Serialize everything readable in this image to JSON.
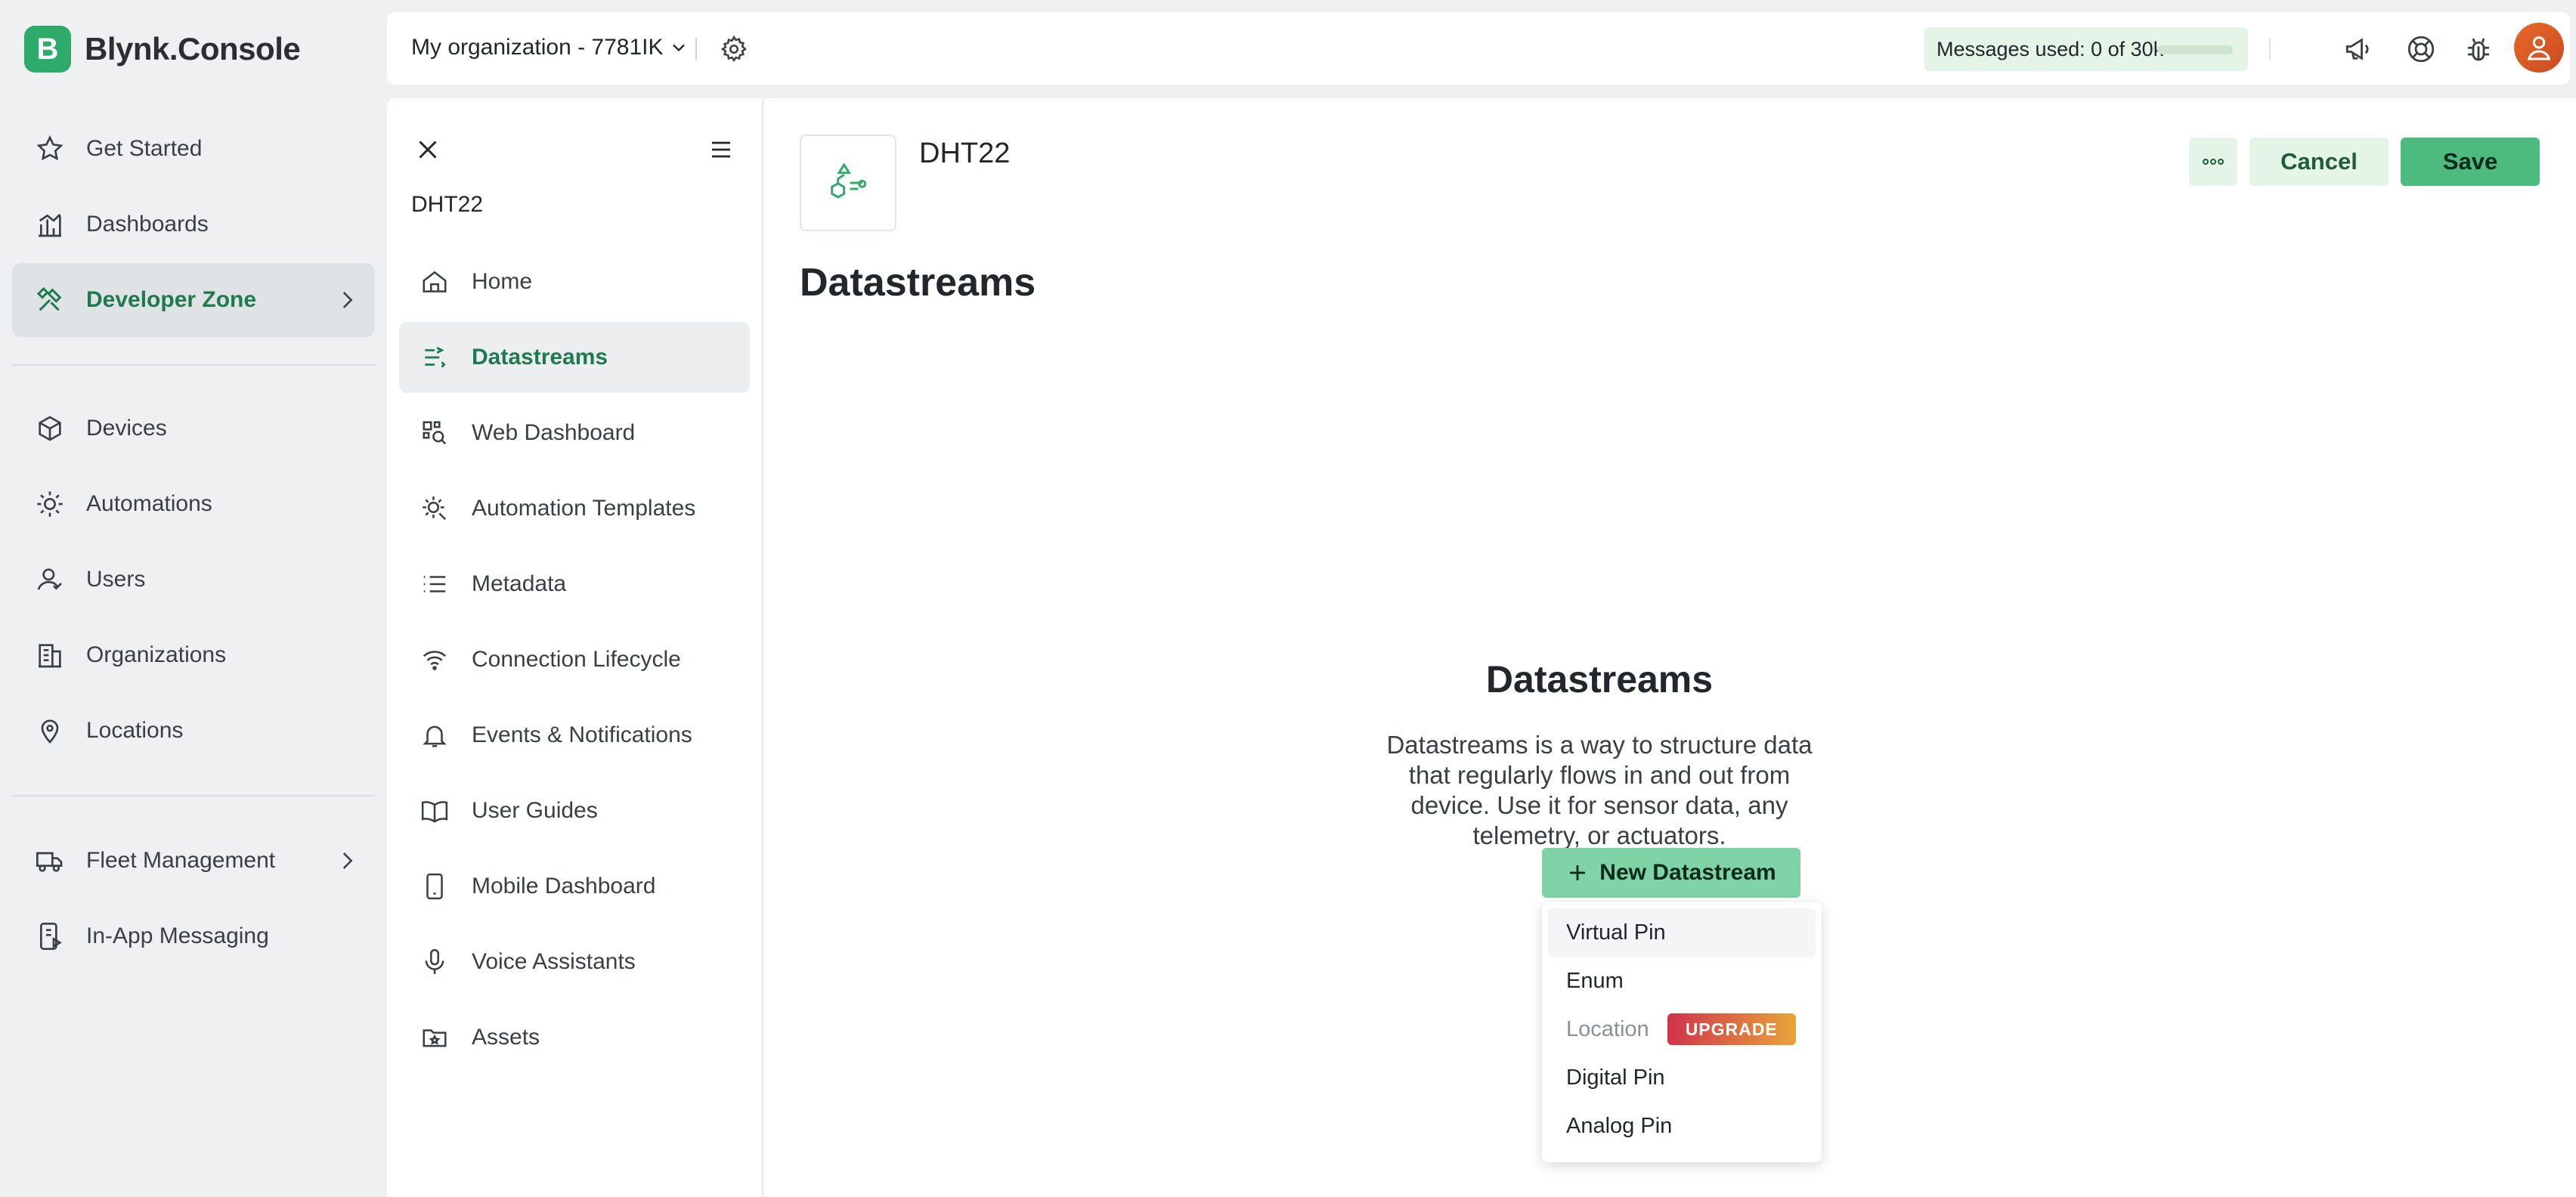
{
  "brand": {
    "letter": "B",
    "name": "Blynk.Console"
  },
  "nav": {
    "items": [
      {
        "label": "Get Started"
      },
      {
        "label": "Dashboards"
      },
      {
        "label": "Developer Zone"
      },
      {
        "label": "Devices"
      },
      {
        "label": "Automations"
      },
      {
        "label": "Users"
      },
      {
        "label": "Organizations"
      },
      {
        "label": "Locations"
      },
      {
        "label": "Fleet Management"
      },
      {
        "label": "In-App Messaging"
      }
    ]
  },
  "topbar": {
    "org_name": "My organization - 7781IK",
    "messages_label": "Messages used:",
    "messages_value": "0 of 30k",
    "messages_fraction": 0.0
  },
  "subnav": {
    "title": "DHT22",
    "items": [
      {
        "label": "Home"
      },
      {
        "label": "Datastreams"
      },
      {
        "label": "Web Dashboard"
      },
      {
        "label": "Automation Templates"
      },
      {
        "label": "Metadata"
      },
      {
        "label": "Connection Lifecycle"
      },
      {
        "label": "Events & Notifications"
      },
      {
        "label": "User Guides"
      },
      {
        "label": "Mobile Dashboard"
      },
      {
        "label": "Voice Assistants"
      },
      {
        "label": "Assets"
      }
    ]
  },
  "main": {
    "template_name": "DHT22",
    "cancel_label": "Cancel",
    "save_label": "Save",
    "page_title": "Datastreams",
    "empty_title": "Datastreams",
    "empty_desc": "Datastreams is a way to structure data that regularly flows in and out from device. Use it for sensor data, any telemetry, or actuators.",
    "new_button_label": "New Datastream"
  },
  "dropdown": {
    "items": [
      {
        "label": "Virtual Pin"
      },
      {
        "label": "Enum"
      },
      {
        "label": "Location",
        "badge": "UPGRADE"
      },
      {
        "label": "Digital Pin"
      },
      {
        "label": "Analog Pin"
      }
    ]
  },
  "colors": {
    "accent": "#2eaa6b",
    "accent_text": "#1f7a4f",
    "save_button": "#4cbb7d",
    "new_button": "#7fd3a6",
    "soft_green": "#e4f4e6"
  }
}
